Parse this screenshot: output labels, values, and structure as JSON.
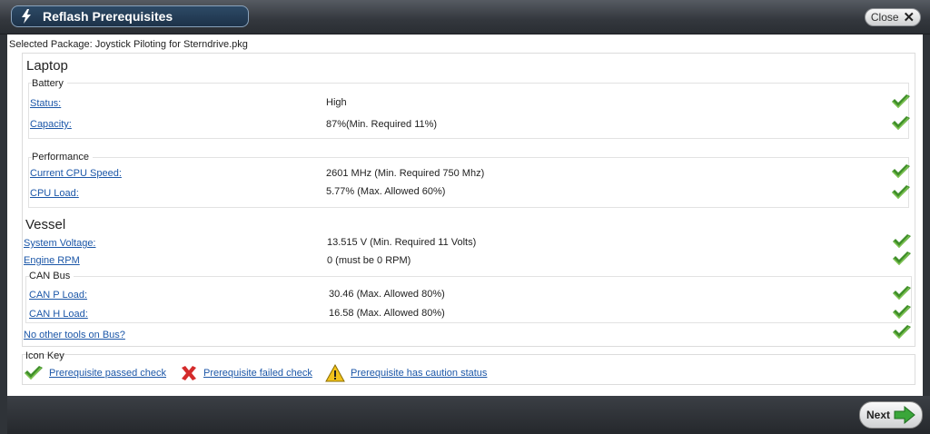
{
  "window": {
    "title": "Reflash Prerequisites",
    "close_label": "Close"
  },
  "package": {
    "label": "Selected Package: Joystick Piloting for Sterndrive.pkg"
  },
  "laptop": {
    "title": "Laptop",
    "battery": {
      "title": "Battery",
      "rows": [
        {
          "label": "Status:",
          "value": "High",
          "status": "passed"
        },
        {
          "label": "Capacity:",
          "value": "87%(Min. Required 11%)",
          "status": "passed"
        }
      ]
    },
    "performance": {
      "title": "Performance",
      "rows": [
        {
          "label": "Current CPU Speed:",
          "value": "2601 MHz (Min. Required 750 Mhz)",
          "status": "passed"
        },
        {
          "label": "CPU Load:",
          "value": "5.77% (Max. Allowed 60%)",
          "status": "passed"
        }
      ]
    }
  },
  "vessel": {
    "title": "Vessel",
    "rows": [
      {
        "label": "System Voltage:",
        "value": "13.515 V (Min. Required 11 Volts)",
        "status": "passed"
      },
      {
        "label": "Engine RPM",
        "value": "0 (must be 0 RPM)",
        "status": "passed"
      }
    ],
    "can_bus": {
      "title": "CAN Bus",
      "rows": [
        {
          "label": "CAN P Load:",
          "value": "30.46 (Max. Allowed 80%)",
          "status": "passed"
        },
        {
          "label": "CAN H Load:",
          "value": "16.58 (Max. Allowed 80%)",
          "status": "passed"
        }
      ]
    },
    "other_tools": {
      "label": "No other tools on Bus?",
      "status": "passed"
    }
  },
  "icon_key": {
    "title": "Icon Key",
    "passed": "Prerequisite passed check",
    "failed": "Prerequisite failed check",
    "caution": "Prerequisite has caution status"
  },
  "footer": {
    "next_label": "Next"
  },
  "colors": {
    "check": "#3f8f2a",
    "fail": "#d42b2b",
    "caution": "#f2c21a",
    "link": "#1c57a8",
    "title_pill": "#1d3249",
    "next_arrow": "#3aa63a"
  }
}
